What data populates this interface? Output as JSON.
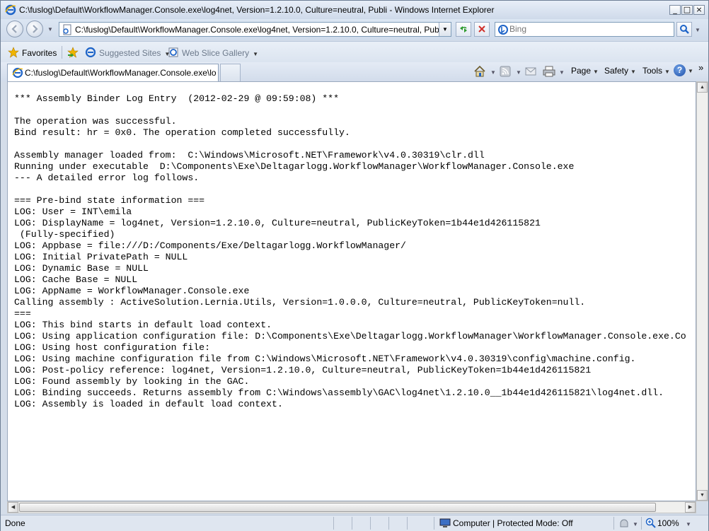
{
  "window": {
    "title": "C:\\fuslog\\Default\\WorkflowManager.Console.exe\\log4net, Version=1.2.10.0, Culture=neutral, Publi - Windows Internet Explorer",
    "minimize_glyph": "_",
    "maximize_glyph": "□",
    "close_glyph": "×"
  },
  "address_bar": {
    "url": "C:\\fuslog\\Default\\WorkflowManager.Console.exe\\log4net, Version=1.2.10.0, Culture=neutral, PublicKeyToke"
  },
  "search": {
    "placeholder": "Bing"
  },
  "favorites_bar": {
    "favorites_label": "Favorites",
    "suggested_sites_label": "Suggested Sites",
    "web_slice_gallery_label": "Web Slice Gallery"
  },
  "tabs": [
    {
      "label": "C:\\fuslog\\Default\\WorkflowManager.Console.exe\\log..."
    }
  ],
  "command_bar": {
    "page_label": "Page",
    "safety_label": "Safety",
    "tools_label": "Tools",
    "help_glyph": "?",
    "overflow_glyph": "»"
  },
  "content": {
    "lines": [
      "*** Assembly Binder Log Entry  (2012-02-29 @ 09:59:08) ***",
      "",
      "The operation was successful.",
      "Bind result: hr = 0x0. The operation completed successfully.",
      "",
      "Assembly manager loaded from:  C:\\Windows\\Microsoft.NET\\Framework\\v4.0.30319\\clr.dll",
      "Running under executable  D:\\Components\\Exe\\Deltagarlogg.WorkflowManager\\WorkflowManager.Console.exe",
      "--- A detailed error log follows.",
      "",
      "=== Pre-bind state information ===",
      "LOG: User = INT\\emila",
      "LOG: DisplayName = log4net, Version=1.2.10.0, Culture=neutral, PublicKeyToken=1b44e1d426115821",
      " (Fully-specified)",
      "LOG: Appbase = file:///D:/Components/Exe/Deltagarlogg.WorkflowManager/",
      "LOG: Initial PrivatePath = NULL",
      "LOG: Dynamic Base = NULL",
      "LOG: Cache Base = NULL",
      "LOG: AppName = WorkflowManager.Console.exe",
      "Calling assembly : ActiveSolution.Lernia.Utils, Version=1.0.0.0, Culture=neutral, PublicKeyToken=null.",
      "===",
      "LOG: This bind starts in default load context.",
      "LOG: Using application configuration file: D:\\Components\\Exe\\Deltagarlogg.WorkflowManager\\WorkflowManager.Console.exe.Co",
      "LOG: Using host configuration file:",
      "LOG: Using machine configuration file from C:\\Windows\\Microsoft.NET\\Framework\\v4.0.30319\\config\\machine.config.",
      "LOG: Post-policy reference: log4net, Version=1.2.10.0, Culture=neutral, PublicKeyToken=1b44e1d426115821",
      "LOG: Found assembly by looking in the GAC.",
      "LOG: Binding succeeds. Returns assembly from C:\\Windows\\assembly\\GAC\\log4net\\1.2.10.0__1b44e1d426115821\\log4net.dll.",
      "LOG: Assembly is loaded in default load context."
    ]
  },
  "status_bar": {
    "status_text": "Done",
    "zone_text": "Computer | Protected Mode: Off",
    "zoom_text": "100%"
  },
  "colors": {
    "ie_blue": "#1e64c8",
    "favorites_star": "#f0b400",
    "refresh_green": "#2e9b2e",
    "stop_red": "#d0302a"
  }
}
